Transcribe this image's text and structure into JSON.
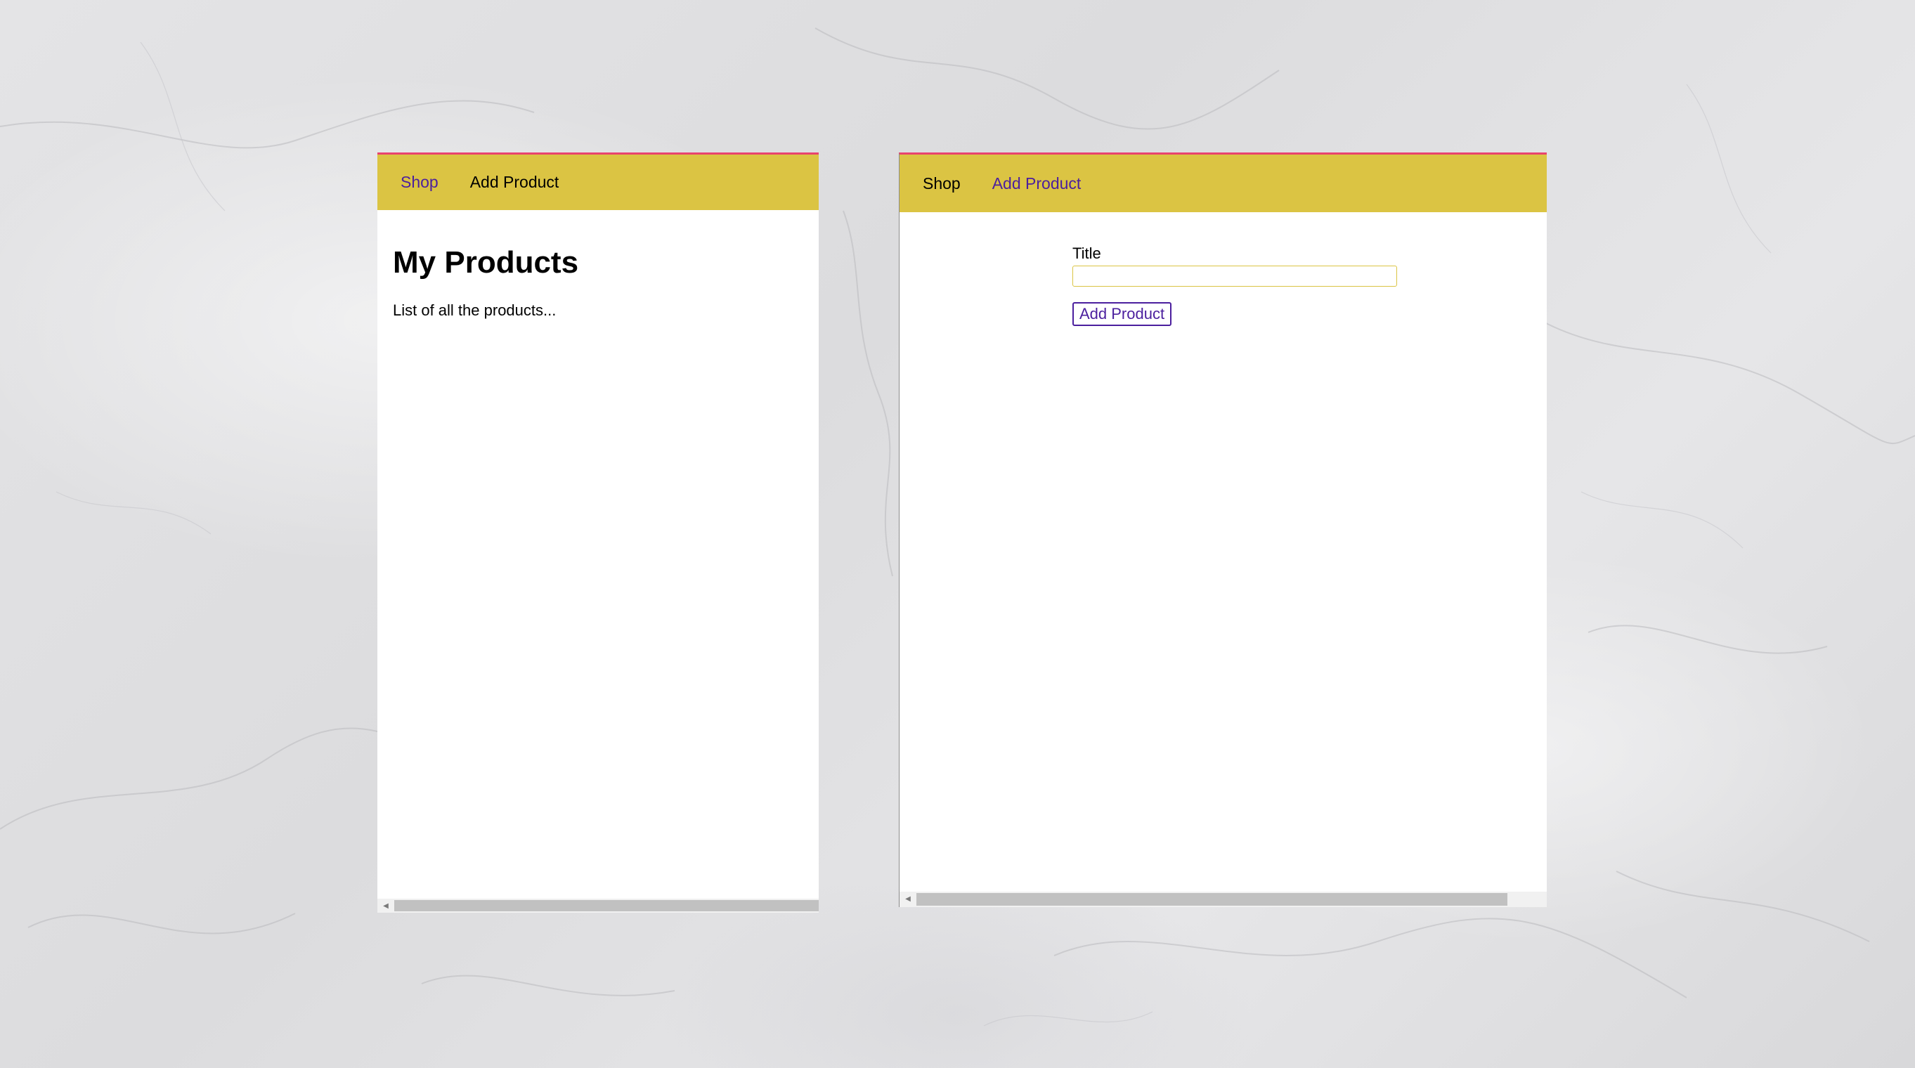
{
  "left_window": {
    "nav": {
      "shop_label": "Shop",
      "add_product_label": "Add Product",
      "active": "shop"
    },
    "heading": "My Products",
    "description": "List of all the products..."
  },
  "right_window": {
    "nav": {
      "shop_label": "Shop",
      "add_product_label": "Add Product",
      "active": "add-product"
    },
    "form": {
      "title_label": "Title",
      "title_value": "",
      "submit_label": "Add Product"
    }
  },
  "icons": {
    "scroll_left": "scroll-left-arrow-icon"
  },
  "colors": {
    "nav_background": "#dbc443",
    "top_accent": "#e8436e",
    "active_link": "#4b1f9e",
    "input_border": "#dbc443"
  }
}
